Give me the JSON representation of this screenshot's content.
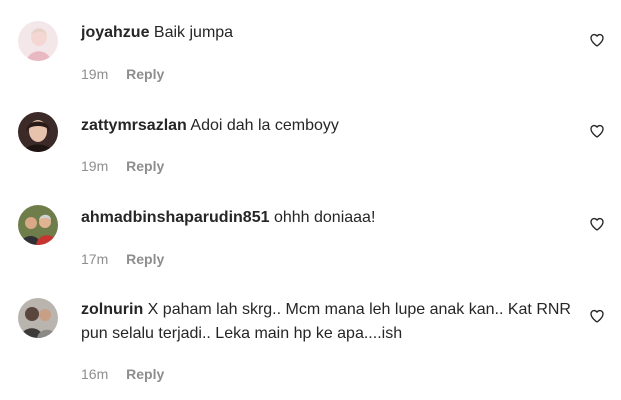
{
  "comments": [
    {
      "username": "joyahzue",
      "text": "Baik jumpa",
      "time": "19m",
      "reply_label": "Reply",
      "like_icon": "heart-outline-icon"
    },
    {
      "username": "zattymrsazlan",
      "text": "Adoi dah la cemboyy",
      "time": "19m",
      "reply_label": "Reply",
      "like_icon": "heart-outline-icon"
    },
    {
      "username": "ahmadbinshaparudin851",
      "text": "ohhh doniaaa!",
      "time": "17m",
      "reply_label": "Reply",
      "like_icon": "heart-outline-icon"
    },
    {
      "username": "zolnurin",
      "text": "X paham lah skrg.. Mcm mana leh lupe anak kan.. Kat RNR pun selalu terjadi.. Leka main hp ke apa....ish",
      "time": "16m",
      "reply_label": "Reply",
      "like_icon": "heart-outline-icon"
    }
  ],
  "colors": {
    "primary_text": "#262626",
    "secondary_text": "#8e8e8e",
    "background": "#ffffff"
  }
}
